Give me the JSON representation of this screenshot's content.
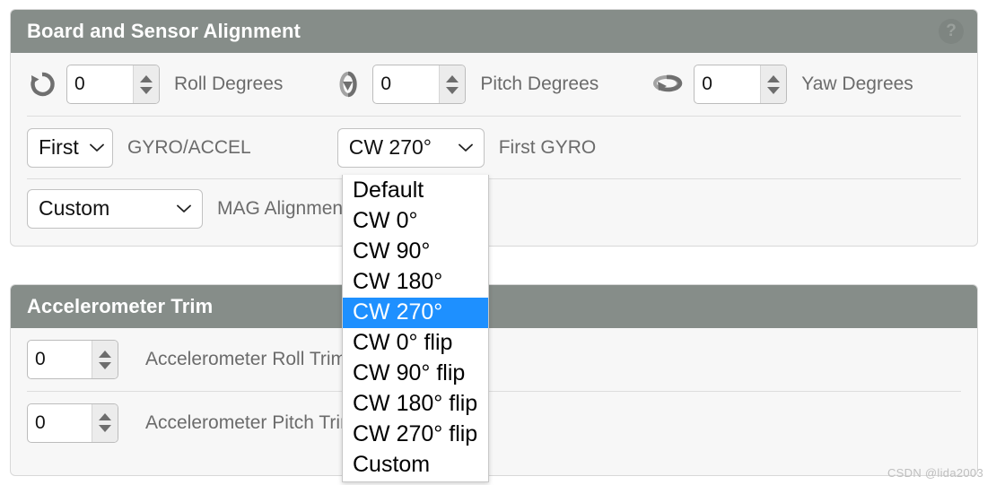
{
  "alignment_panel": {
    "title": "Board and Sensor Alignment",
    "help_icon": "question-mark-icon",
    "help_label": "?",
    "roll": {
      "icon": "roll-rotation-icon",
      "value": "0",
      "label": "Roll Degrees"
    },
    "pitch": {
      "icon": "pitch-rotation-icon",
      "value": "0",
      "label": "Pitch Degrees"
    },
    "yaw": {
      "icon": "yaw-rotation-icon",
      "value": "0",
      "label": "Yaw Degrees"
    },
    "gyro_accel": {
      "selected": "First",
      "label": "GYRO/ACCEL"
    },
    "first_gyro": {
      "selected": "CW 270°",
      "label": "First GYRO",
      "open": true,
      "options": [
        "Default",
        "CW 0°",
        "CW 90°",
        "CW 180°",
        "CW 270°",
        "CW 0° flip",
        "CW 90° flip",
        "CW 180° flip",
        "CW 270° flip",
        "Custom"
      ],
      "selected_index": 4
    },
    "mag_alignment": {
      "selected": "Custom",
      "label": "MAG Alignment"
    }
  },
  "acc_trim_panel": {
    "title": "Accelerometer Trim",
    "roll": {
      "value": "0",
      "label": "Accelerometer Roll Trim"
    },
    "pitch": {
      "value": "0",
      "label": "Accelerometer Pitch Trim"
    }
  },
  "watermark": "CSDN @lida2003",
  "colors": {
    "header_grey": "#868d89",
    "panel_bg": "#f7f7f7",
    "highlight_blue": "#1e90ff",
    "label_grey": "#6b6b6b"
  }
}
